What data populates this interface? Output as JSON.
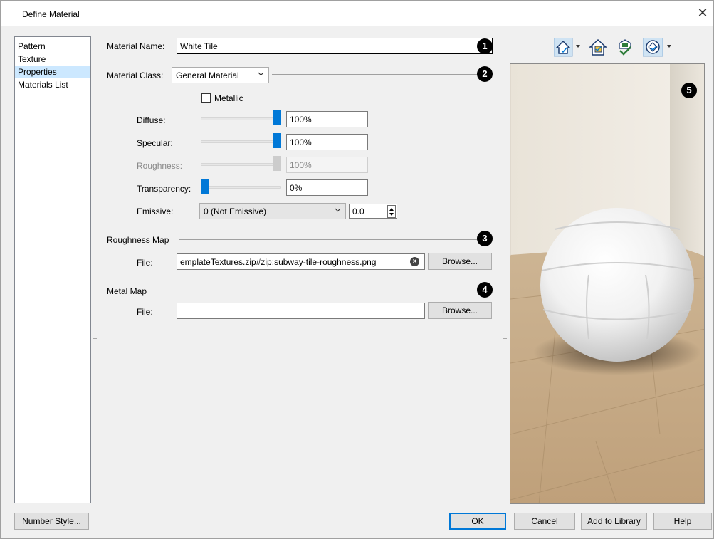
{
  "window": {
    "title": "Define Material",
    "close_glyph": "✕"
  },
  "nav": {
    "items": [
      {
        "label": "Pattern",
        "selected": false
      },
      {
        "label": "Texture",
        "selected": false
      },
      {
        "label": "Properties",
        "selected": true
      },
      {
        "label": "Materials List",
        "selected": false
      }
    ]
  },
  "form": {
    "material_name_label": "Material Name:",
    "material_name_value": "White Tile",
    "material_class_label": "Material Class:",
    "material_class_value": "General Material",
    "metallic_label": "Metallic",
    "metallic_checked": false,
    "diffuse_label": "Diffuse:",
    "diffuse_value": "100%",
    "diffuse_level": 1.0,
    "specular_label": "Specular:",
    "specular_value": "100%",
    "specular_level": 1.0,
    "roughness_label": "Roughness:",
    "roughness_value": "100%",
    "roughness_level": 1.0,
    "transparency_label": "Transparency:",
    "transparency_value": "0%",
    "transparency_level": 0.0,
    "emissive_label": "Emissive:",
    "emissive_value": "0 (Not Emissive)",
    "emissive_amount": "0.0",
    "roughness_map_heading": "Roughness Map",
    "roughness_map_file_label": "File:",
    "roughness_map_file_value": "emplateTextures.zip#zip:subway-tile-roughness.png",
    "metal_map_heading": "Metal Map",
    "metal_map_file_label": "File:",
    "metal_map_file_value": "",
    "browse_label": "Browse..."
  },
  "callouts": [
    "1",
    "2",
    "3",
    "4",
    "5"
  ],
  "preview_toolbar": {
    "icons": [
      "camera-view-icon",
      "render-preview-icon",
      "material-check-icon",
      "lighting-options-icon"
    ]
  },
  "footer": {
    "number_style": "Number Style...",
    "ok": "OK",
    "cancel": "Cancel",
    "add_to_library": "Add to Library",
    "help": "Help"
  },
  "colors": {
    "accent": "#0078d7",
    "selection": "#cce8ff",
    "floor": "#c7ad8a",
    "wall": "#ebe6de"
  }
}
